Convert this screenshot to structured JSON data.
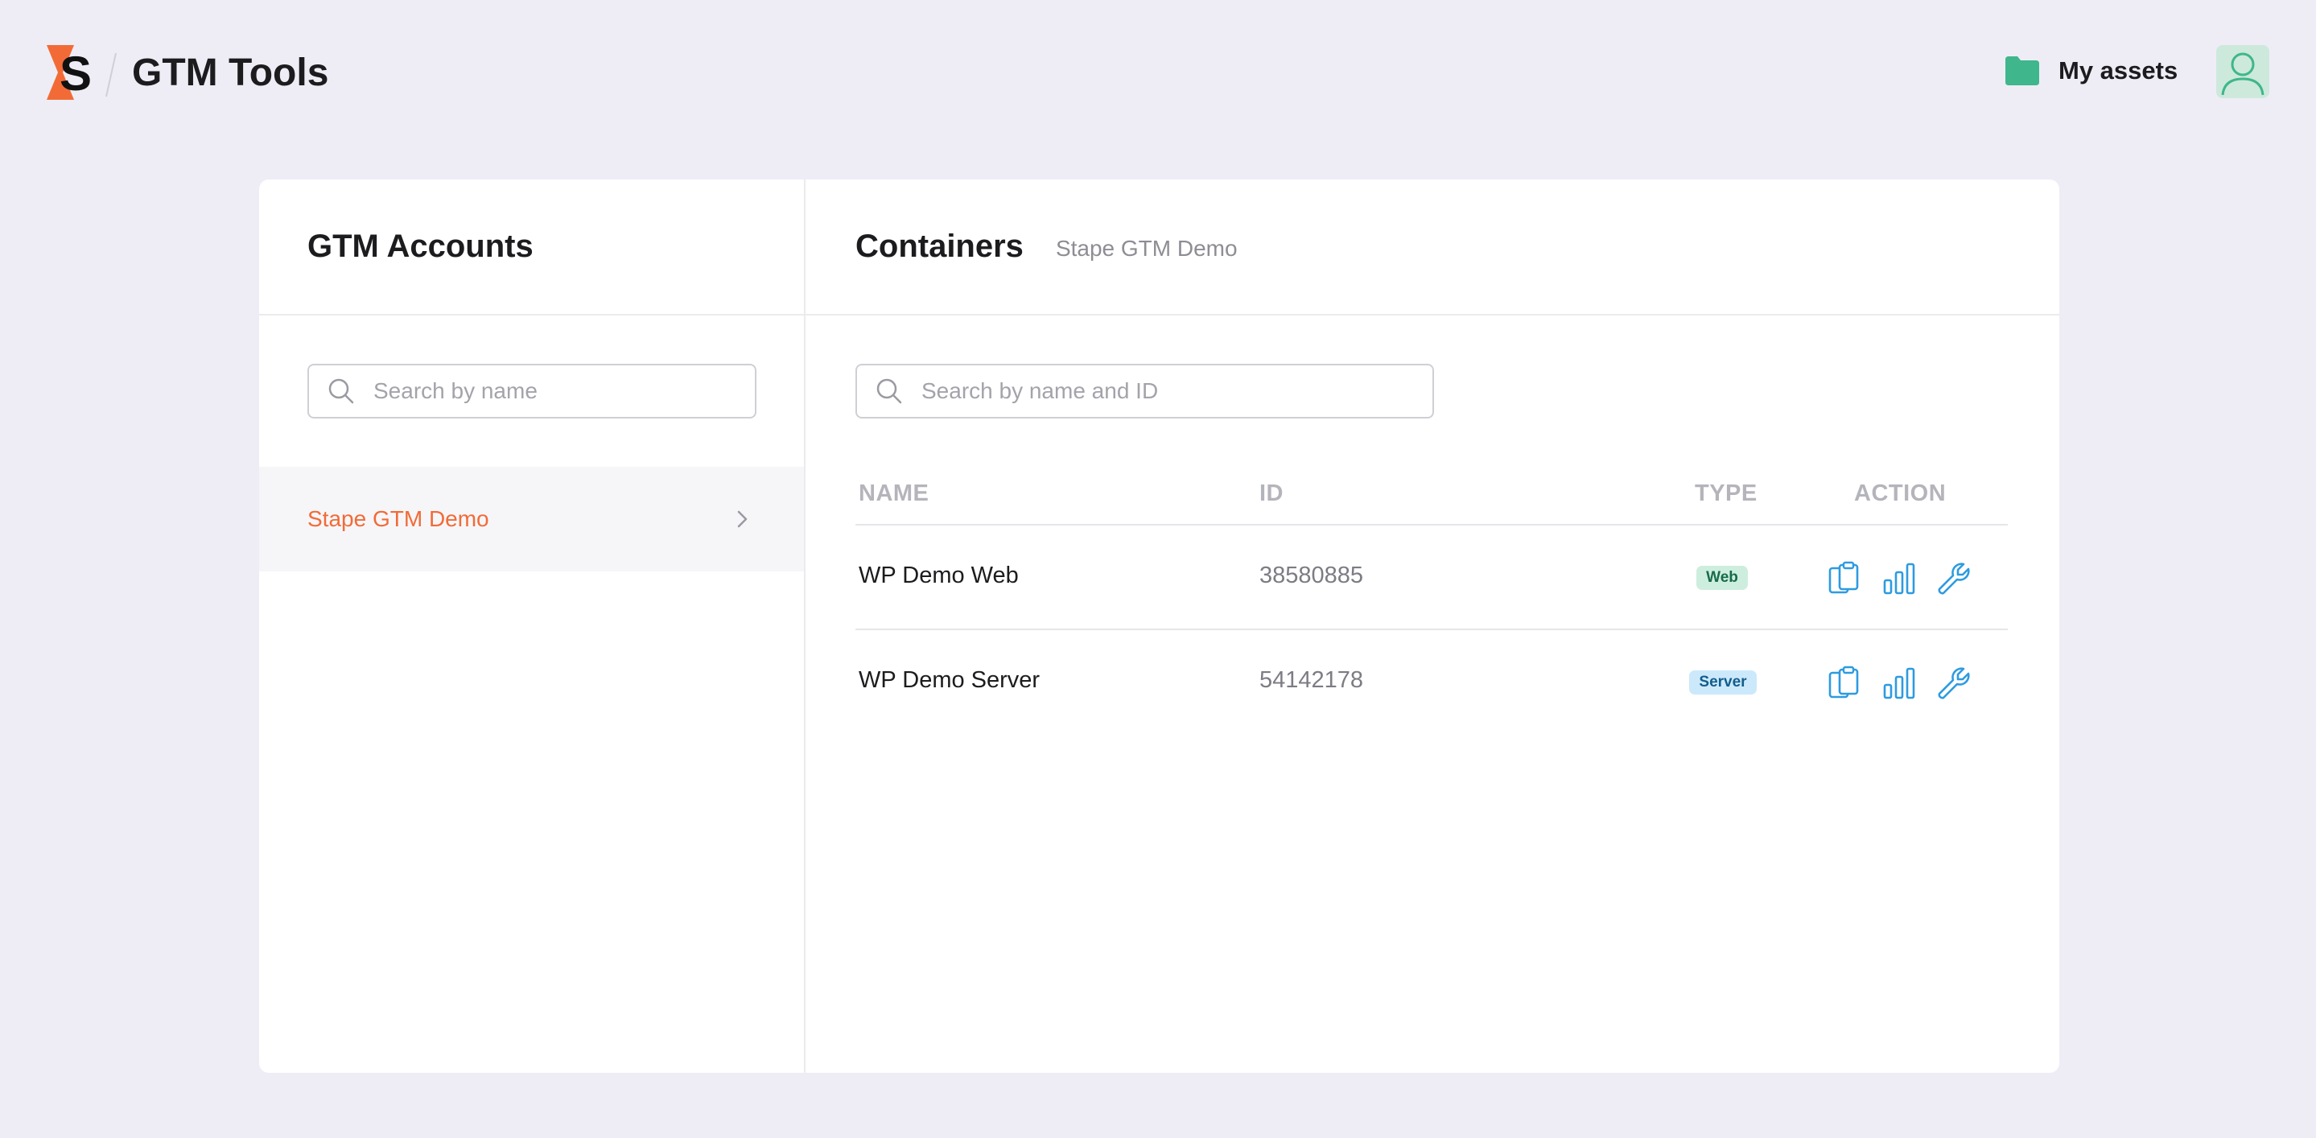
{
  "header": {
    "app_title": "GTM Tools",
    "my_assets_label": "My assets"
  },
  "left_pane": {
    "title": "GTM Accounts",
    "search_placeholder": "Search by name",
    "accounts": [
      {
        "label": "Stape GTM Demo",
        "selected": true
      }
    ]
  },
  "right_pane": {
    "title": "Containers",
    "subtitle": "Stape GTM Demo",
    "search_placeholder": "Search by name and ID",
    "columns": {
      "name": "NAME",
      "id": "ID",
      "type": "TYPE",
      "action": "ACTION"
    },
    "rows": [
      {
        "name": "WP Demo Web",
        "id": "38580885",
        "type": "Web"
      },
      {
        "name": "WP Demo Server",
        "id": "54142178",
        "type": "Server"
      }
    ],
    "action_icons": [
      "clipboard-icon",
      "bar-chart-icon",
      "wrench-icon"
    ]
  },
  "colors": {
    "accent_orange": "#f26b36",
    "action_blue": "#2d9be0",
    "folder_green": "#3fb68b",
    "badge_web_bg": "#cdeedf",
    "badge_web_text": "#176b4a",
    "badge_server_bg": "#cce9fb",
    "badge_server_text": "#135d8c",
    "background": "#eeedf6"
  }
}
